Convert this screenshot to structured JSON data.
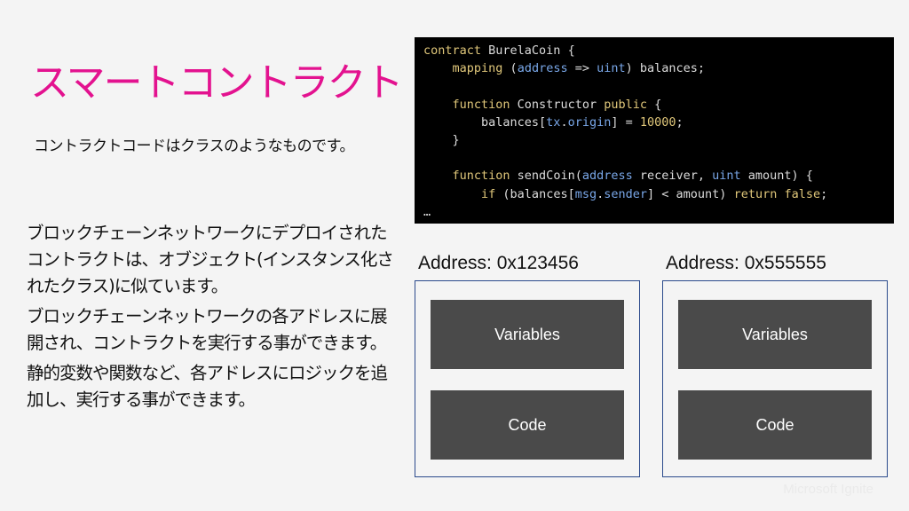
{
  "slide": {
    "title": "スマートコントラクト",
    "subtitle": "コントラクトコードはクラスのようなものです。",
    "bullets": [
      "ブロックチェーンネットワークにデプロイされたコントラクトは、オブジェクト(インスタンス化されたクラス)に似ています。",
      "ブロックチェーンネットワークの各アドレスに展開され、コントラクトを実行する事ができます。",
      "静的変数や関数など、各アドレスにロジックを追加し、実行する事ができます。"
    ]
  },
  "code": {
    "lines": [
      "contract BurelaCoin {",
      "    mapping (address => uint) balances;",
      "",
      "    function Constructor public {",
      "        balances[tx.origin] = 10000;",
      "    }",
      "",
      "    function sendCoin(address receiver, uint amount) {",
      "        if (balances[msg.sender] < amount) return false;",
      "…"
    ]
  },
  "addresses": [
    {
      "label": "Address: 0x123456",
      "variables": "Variables",
      "code": "Code"
    },
    {
      "label": "Address: 0x555555",
      "variables": "Variables",
      "code": "Code"
    }
  ],
  "watermark": "Microsoft Ignite",
  "colors": {
    "title": "#e3128f",
    "block": "#4a4a4a",
    "border": "#2b4a8c"
  }
}
